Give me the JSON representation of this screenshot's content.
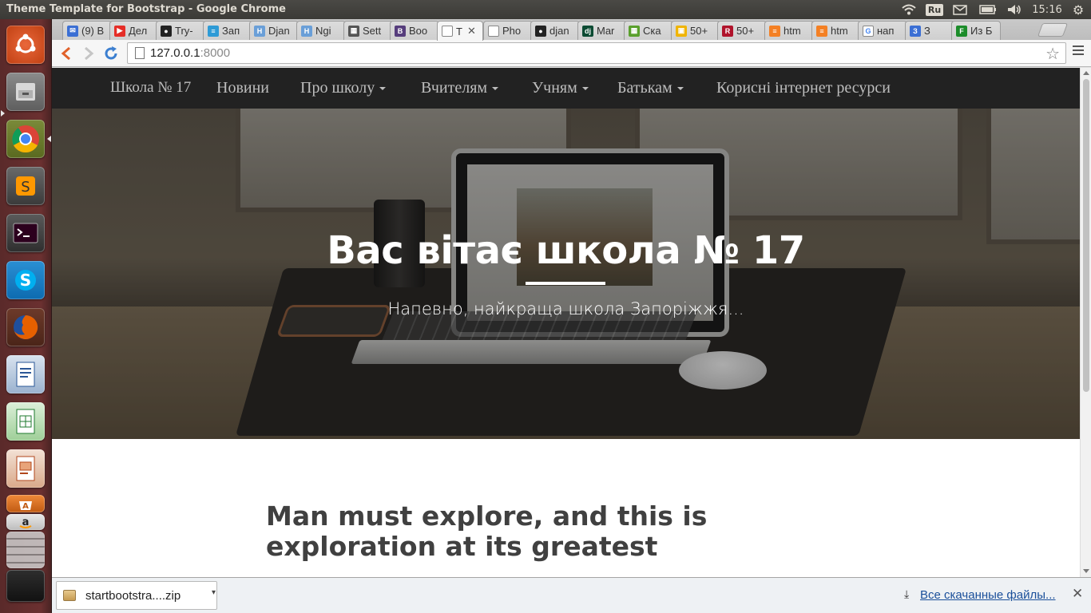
{
  "system": {
    "window_title": "Theme Template for Bootstrap - Google Chrome",
    "keyboard_layout": "Ru",
    "clock": "15:16"
  },
  "launcher": {
    "icons": [
      "ubuntu-dash-icon",
      "files-icon",
      "chrome-icon",
      "sublime-text-icon",
      "terminal-icon",
      "skype-icon",
      "firefox-icon",
      "libreoffice-writer-icon",
      "libreoffice-calc-icon",
      "libreoffice-impress-icon",
      "software-center-icon",
      "amazon-icon",
      "trash-icon"
    ]
  },
  "tabs": [
    {
      "label": "(9) В",
      "color": "#3b6fd4",
      "glyph": "✉"
    },
    {
      "label": "Дел",
      "color": "#e52d27",
      "glyph": "▶"
    },
    {
      "label": "Try-",
      "color": "#222222",
      "glyph": "●"
    },
    {
      "label": "Зап",
      "color": "#2e9bd6",
      "glyph": "≡"
    },
    {
      "label": "Djan",
      "color": "#6a9fd8",
      "glyph": "H"
    },
    {
      "label": "Ngi",
      "color": "#6a9fd8",
      "glyph": "H"
    },
    {
      "label": "Sett",
      "color": "#555555",
      "glyph": "▦"
    },
    {
      "label": "Boo",
      "color": "#563d7c",
      "glyph": "B"
    },
    {
      "label": "T",
      "color": "#ffffff",
      "glyph": "",
      "active": true
    },
    {
      "label": "Pho",
      "color": "#ffffff",
      "glyph": ""
    },
    {
      "label": "djan",
      "color": "#222222",
      "glyph": "●"
    },
    {
      "label": "Mar",
      "color": "#0c4b33",
      "glyph": "dj"
    },
    {
      "label": "Ска",
      "color": "#5aa02c",
      "glyph": "▦"
    },
    {
      "label": "50+",
      "color": "#f0b400",
      "glyph": "▣"
    },
    {
      "label": "50+",
      "color": "#b0132b",
      "glyph": "R"
    },
    {
      "label": "htm",
      "color": "#f48024",
      "glyph": "≡"
    },
    {
      "label": "htm",
      "color": "#f48024",
      "glyph": "≡"
    },
    {
      "label": "нап",
      "color": "#ffffff",
      "glyph": "G"
    },
    {
      "label": "З",
      "color": "#3b6fd4",
      "glyph": "З"
    },
    {
      "label": "Из Б",
      "color": "#1c8c2a",
      "glyph": "F"
    }
  ],
  "toolbar": {
    "url_host": "127.0.0.1",
    "url_port": ":8000"
  },
  "navbar": {
    "brand": "Школа № 17",
    "links": [
      "Новини",
      "Про школу",
      "Вчителям",
      "Учням",
      "Батькам",
      "Корисні інтернет ресурси"
    ],
    "dropdowns": [
      false,
      true,
      true,
      true,
      true,
      false
    ]
  },
  "hero": {
    "title": "Вас вітає школа № 17",
    "subtitle": "Напевно, найкраща школа Запоріжжя..."
  },
  "post": {
    "title": "Man must explore, and this is exploration at its greatest"
  },
  "downloads": {
    "file_name": "startbootstra....zip",
    "show_all": "Все скачанные файлы..."
  },
  "colors": {
    "navbar_bg": "#222222",
    "nav_link": "#bdbdbd",
    "post_title": "#404040",
    "launcher_bg": "#6b3030"
  }
}
